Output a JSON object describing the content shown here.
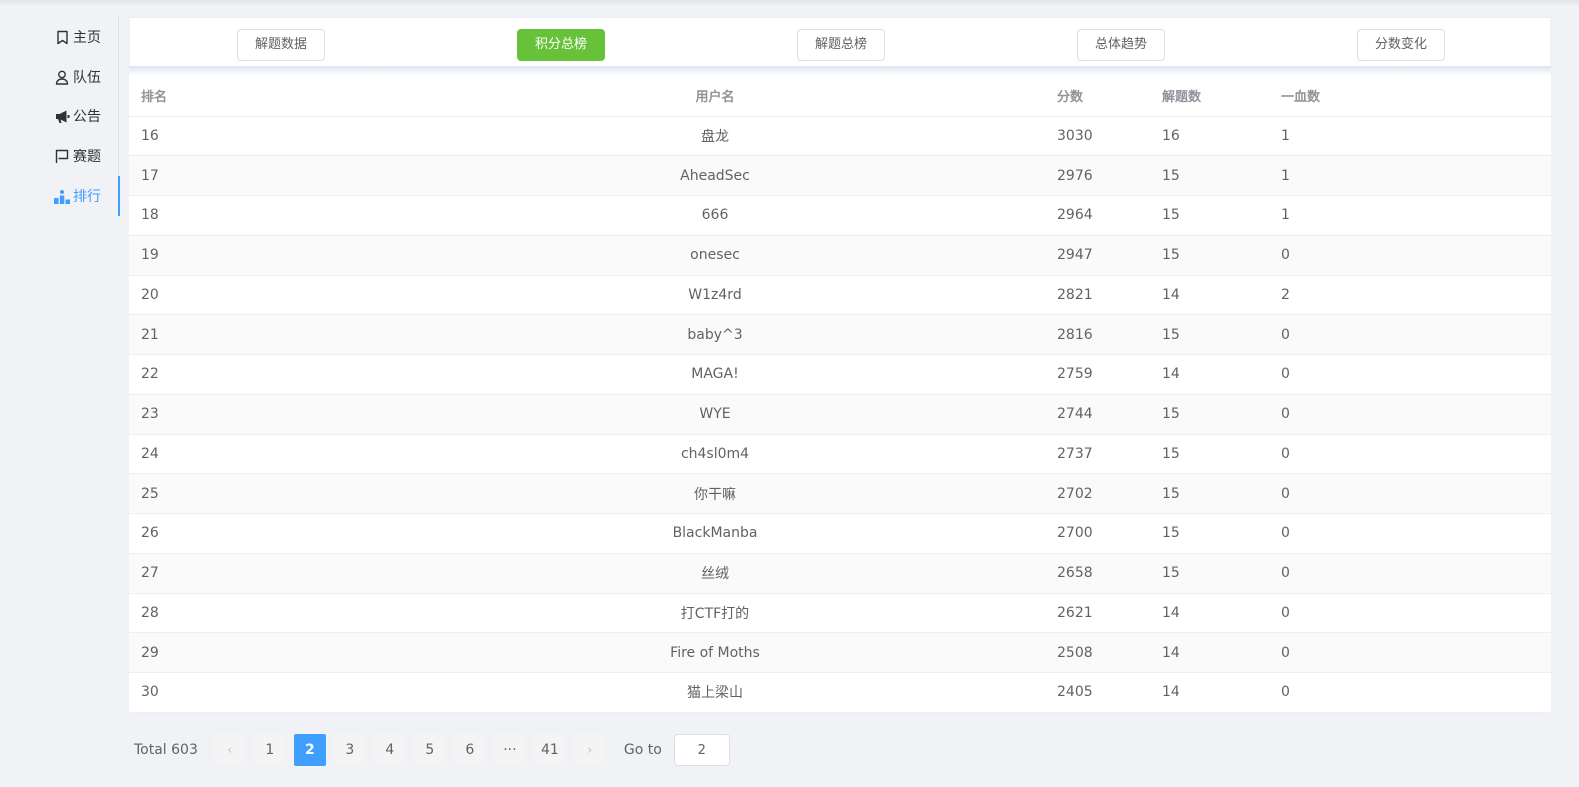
{
  "sidebar": {
    "items": [
      {
        "label": "主页",
        "icon": "bookmark-icon"
      },
      {
        "label": "队伍",
        "icon": "user-icon"
      },
      {
        "label": "公告",
        "icon": "megaphone-icon"
      },
      {
        "label": "赛题",
        "icon": "flag-icon"
      },
      {
        "label": "排行",
        "icon": "ranking-icon",
        "active": true
      }
    ]
  },
  "tabs": [
    {
      "label": "解题数据"
    },
    {
      "label": "积分总榜",
      "active": true
    },
    {
      "label": "解题总榜"
    },
    {
      "label": "总体趋势"
    },
    {
      "label": "分数变化"
    }
  ],
  "table": {
    "headers": [
      "排名",
      "用户名",
      "分数",
      "解题数",
      "一血数"
    ],
    "rows": [
      [
        "16",
        "盘龙",
        "3030",
        "16",
        "1"
      ],
      [
        "17",
        "AheadSec",
        "2976",
        "15",
        "1"
      ],
      [
        "18",
        "666",
        "2964",
        "15",
        "1"
      ],
      [
        "19",
        "onesec",
        "2947",
        "15",
        "0"
      ],
      [
        "20",
        "W1z4rd",
        "2821",
        "14",
        "2"
      ],
      [
        "21",
        "baby^3",
        "2816",
        "15",
        "0"
      ],
      [
        "22",
        "MAGA!",
        "2759",
        "14",
        "0"
      ],
      [
        "23",
        "WYE",
        "2744",
        "15",
        "0"
      ],
      [
        "24",
        "ch4sl0m4",
        "2737",
        "15",
        "0"
      ],
      [
        "25",
        "你干嘛",
        "2702",
        "15",
        "0"
      ],
      [
        "26",
        "BlackManba",
        "2700",
        "15",
        "0"
      ],
      [
        "27",
        "丝绒",
        "2658",
        "15",
        "0"
      ],
      [
        "28",
        "打CTF打的",
        "2621",
        "14",
        "0"
      ],
      [
        "29",
        "Fire of Moths",
        "2508",
        "14",
        "0"
      ],
      [
        "30",
        "猫上梁山",
        "2405",
        "14",
        "0"
      ]
    ]
  },
  "pagination": {
    "total": "Total 603",
    "pages": [
      "1",
      "2",
      "3",
      "4",
      "5",
      "6",
      "···",
      "41"
    ],
    "current": "2",
    "prev": "‹",
    "next": "›",
    "goto_label": "Go to",
    "goto_value": "2"
  },
  "colors": {
    "accent": "#409eff",
    "active_tab": "#67c23a"
  }
}
